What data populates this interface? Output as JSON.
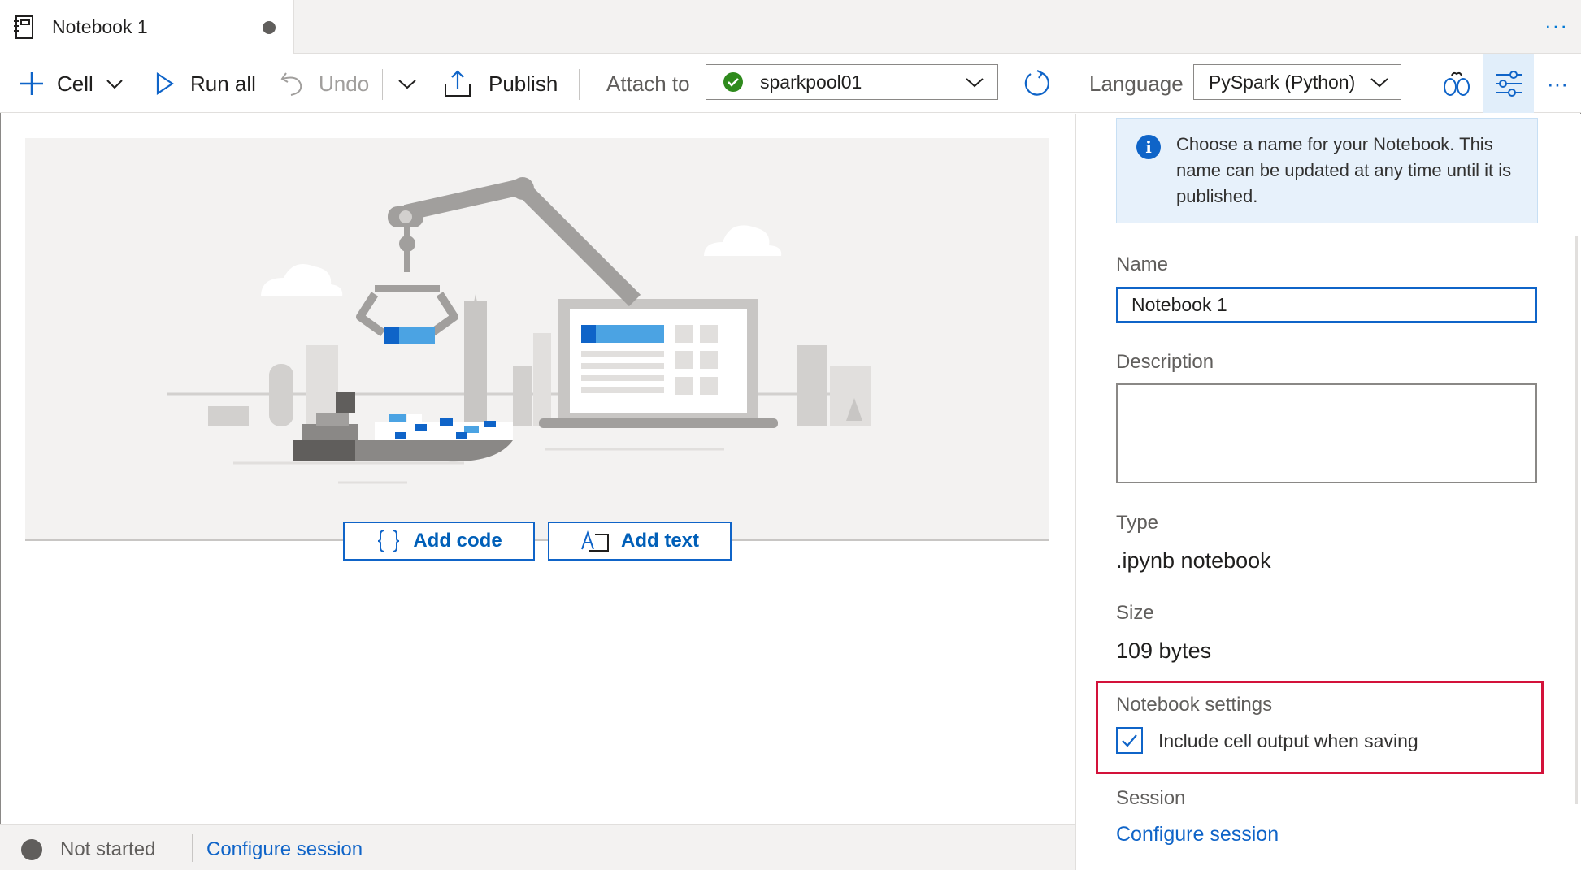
{
  "tab": {
    "title": "Notebook 1",
    "more_label": "···"
  },
  "toolbar": {
    "cell_label": "Cell",
    "run_all_label": "Run all",
    "undo_label": "Undo",
    "publish_label": "Publish",
    "attach_to_label": "Attach to",
    "attach_value": "sparkpool01",
    "language_label": "Language",
    "language_value": "PySpark (Python)",
    "more_label": "···",
    "icons": [
      "plus-icon",
      "chevron-down-icon",
      "play-icon",
      "undo-icon",
      "chevron-down-icon",
      "publish-icon",
      "check-circle-icon",
      "refresh-icon",
      "spark-config-icon",
      "properties-icon",
      "more-icon"
    ]
  },
  "canvas": {
    "add_code_label": "Add code",
    "add_text_label": "Add text"
  },
  "statusbar": {
    "status": "Not started",
    "configure_label": "Configure session"
  },
  "panel": {
    "info_text": "Choose a name for your Notebook. This name can be updated at any time until it is published.",
    "name_label": "Name",
    "name_value": "Notebook 1",
    "description_label": "Description",
    "description_value": "",
    "type_label": "Type",
    "type_value": ".ipynb notebook",
    "size_label": "Size",
    "size_value": "109 bytes",
    "settings_label": "Notebook settings",
    "include_output_label": "Include cell output when saving",
    "include_output_checked": true,
    "session_label": "Session",
    "configure_label": "Configure session"
  },
  "colors": {
    "accent": "#0f64c8",
    "success": "#2f8a1d",
    "highlight": "#d3123a",
    "illustration_blue": "#4ba3e3"
  }
}
